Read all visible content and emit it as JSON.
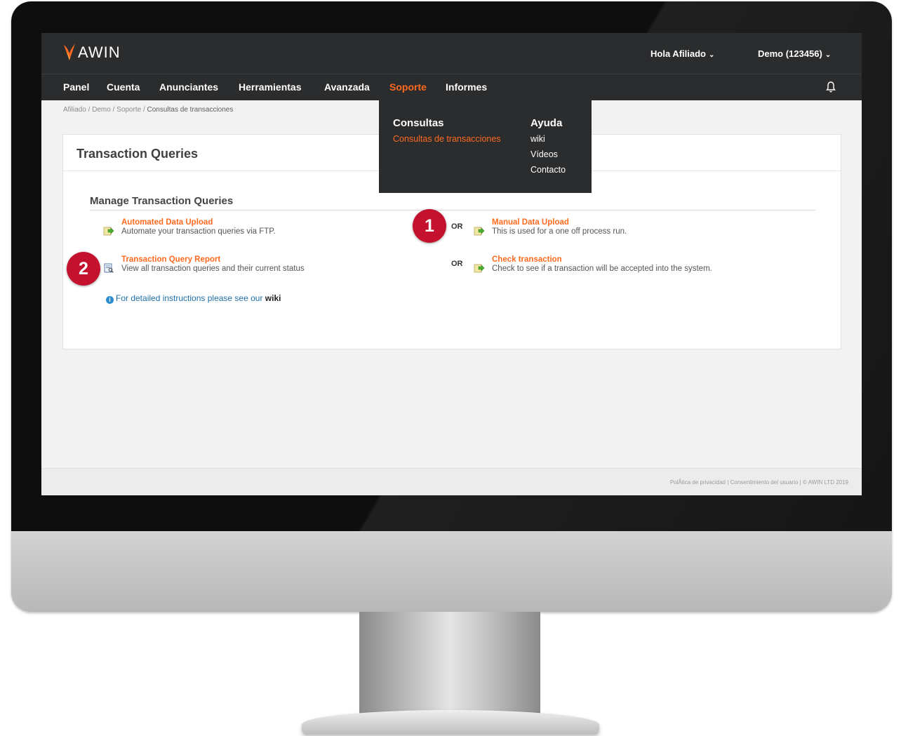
{
  "header": {
    "logo_text": "AWIN",
    "greeting": "Hola Afiliado",
    "account": "Demo (123456)"
  },
  "nav": {
    "items": [
      {
        "label": "Panel"
      },
      {
        "label": "Cuenta"
      },
      {
        "label": "Anunciantes"
      },
      {
        "label": "Herramientas"
      },
      {
        "label": "Avanzada"
      },
      {
        "label": "Soporte",
        "active": true
      },
      {
        "label": "Informes"
      }
    ]
  },
  "breadcrumb": {
    "trail": "Afiliado / Demo / Soporte / ",
    "current": "Consultas de transacciones"
  },
  "dropdown": {
    "col1_title": "Consultas",
    "col1_items": [
      "Consultas de transacciones"
    ],
    "col2_title": "Ayuda",
    "col2_items": [
      "wiki",
      "Vídeos",
      "Contacto"
    ]
  },
  "page": {
    "title": "Transaction Queries",
    "section_title": "Manage Transaction Queries",
    "or_label": "OR",
    "options": [
      {
        "title": "Automated Data Upload",
        "desc": "Automate your transaction queries via FTP."
      },
      {
        "title": "Manual Data Upload",
        "desc": "This is used for a one off process run."
      },
      {
        "title": "Transaction Query Report",
        "desc": "View all transaction queries and their current status"
      },
      {
        "title": "Check transaction",
        "desc": "Check to see if a transaction will be accepted into the system."
      }
    ],
    "info_text": "For detailed instructions please see our ",
    "info_link": "wiki"
  },
  "footer": {
    "text": "PolÃtica de privacidad | Consentimiento del usuario | © AWIN LTD 2019"
  },
  "callouts": [
    "1",
    "2"
  ],
  "colors": {
    "accent": "#ff6a1f",
    "topbar": "#2b2c2e",
    "callout": "#c4112e",
    "info": "#1f6fa6"
  }
}
